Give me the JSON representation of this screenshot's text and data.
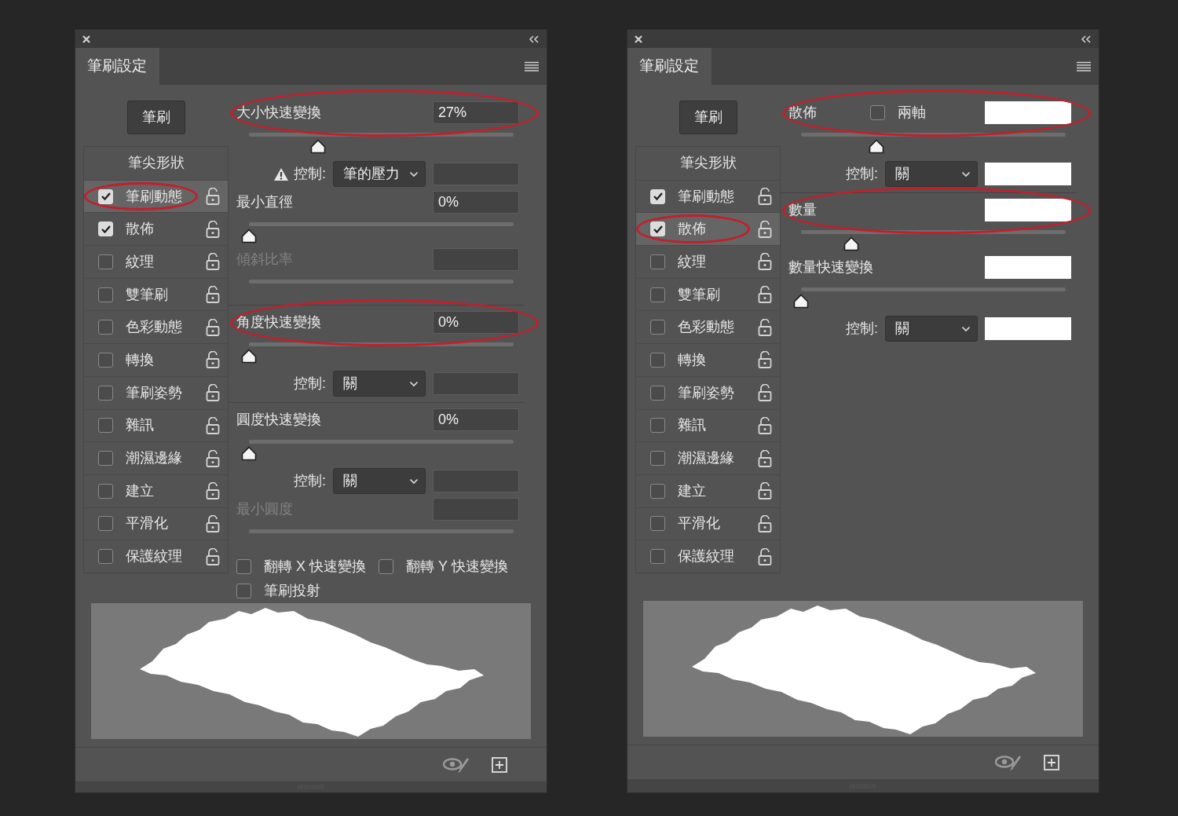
{
  "panels": [
    {
      "title": "筆刷設定",
      "tab_selected": true,
      "brush_button": "筆刷",
      "categories": [
        {
          "kind": "header",
          "label": "筆尖形狀"
        },
        {
          "kind": "option",
          "label": "筆刷動態",
          "checked": true,
          "selected": true,
          "circled": true
        },
        {
          "kind": "option",
          "label": "散佈",
          "checked": true,
          "selected": false,
          "circled": false
        },
        {
          "kind": "option",
          "label": "紋理",
          "checked": false,
          "selected": false,
          "circled": false
        },
        {
          "kind": "option",
          "label": "雙筆刷",
          "checked": false,
          "selected": false,
          "circled": false
        },
        {
          "kind": "option",
          "label": "色彩動態",
          "checked": false,
          "selected": false,
          "circled": false
        },
        {
          "kind": "option",
          "label": "轉換",
          "checked": false,
          "selected": false,
          "circled": false
        },
        {
          "kind": "option",
          "label": "筆刷姿勢",
          "checked": false,
          "selected": false,
          "circled": false
        },
        {
          "kind": "option",
          "label": "雜訊",
          "checked": false,
          "selected": false,
          "circled": false
        },
        {
          "kind": "option",
          "label": "潮濕邊緣",
          "checked": false,
          "selected": false,
          "circled": false
        },
        {
          "kind": "option",
          "label": "建立",
          "checked": false,
          "selected": false,
          "circled": false
        },
        {
          "kind": "option",
          "label": "平滑化",
          "checked": false,
          "selected": false,
          "circled": false
        },
        {
          "kind": "option",
          "label": "保護紋理",
          "checked": false,
          "selected": false,
          "circled": false
        }
      ],
      "settings": [
        {
          "kind": "slider",
          "label": "大小快速變換",
          "value": "27%",
          "level": 0.26,
          "disabled": false,
          "circled": true,
          "blanked": false
        },
        {
          "kind": "control",
          "label": "控制:",
          "option": "筆的壓力",
          "warning": true,
          "blanked": false
        },
        {
          "kind": "slider",
          "label": "最小直徑",
          "value": "0%",
          "level": 0,
          "disabled": false,
          "circled": false,
          "blanked": false
        },
        {
          "kind": "slider",
          "label": "傾斜比率",
          "disabled": true,
          "circled": false,
          "blanked": false
        },
        {
          "kind": "divider"
        },
        {
          "kind": "slider",
          "label": "角度快速變換",
          "value": "0%",
          "level": 0,
          "disabled": false,
          "circled": true,
          "blanked": false
        },
        {
          "kind": "control",
          "label": "控制:",
          "option": "關",
          "warning": false,
          "blanked": false
        },
        {
          "kind": "divider"
        },
        {
          "kind": "slider",
          "label": "圓度快速變換",
          "value": "0%",
          "level": 0,
          "disabled": false,
          "circled": false,
          "blanked": false
        },
        {
          "kind": "control",
          "label": "控制:",
          "option": "關",
          "warning": false,
          "blanked": false
        },
        {
          "kind": "slider",
          "label": "最小圓度",
          "disabled": true,
          "circled": false,
          "blanked": false
        },
        {
          "kind": "checkboxes",
          "items": [
            {
              "label": "翻轉 X 快速變換",
              "checked": false
            },
            {
              "label": "翻轉 Y 快速變換",
              "checked": false
            }
          ]
        },
        {
          "kind": "checkboxes",
          "items": [
            {
              "label": "筆刷投射",
              "checked": false
            }
          ]
        }
      ]
    },
    {
      "title": "筆刷設定",
      "tab_selected": true,
      "brush_button": "筆刷",
      "categories": [
        {
          "kind": "header",
          "label": "筆尖形狀"
        },
        {
          "kind": "option",
          "label": "筆刷動態",
          "checked": true,
          "selected": false,
          "circled": false
        },
        {
          "kind": "option",
          "label": "散佈",
          "checked": true,
          "selected": true,
          "circled": true
        },
        {
          "kind": "option",
          "label": "紋理",
          "checked": false,
          "selected": false,
          "circled": false
        },
        {
          "kind": "option",
          "label": "雙筆刷",
          "checked": false,
          "selected": false,
          "circled": false
        },
        {
          "kind": "option",
          "label": "色彩動態",
          "checked": false,
          "selected": false,
          "circled": false
        },
        {
          "kind": "option",
          "label": "轉換",
          "checked": false,
          "selected": false,
          "circled": false
        },
        {
          "kind": "option",
          "label": "筆刷姿勢",
          "checked": false,
          "selected": false,
          "circled": false
        },
        {
          "kind": "option",
          "label": "雜訊",
          "checked": false,
          "selected": false,
          "circled": false
        },
        {
          "kind": "option",
          "label": "潮濕邊緣",
          "checked": false,
          "selected": false,
          "circled": false
        },
        {
          "kind": "option",
          "label": "建立",
          "checked": false,
          "selected": false,
          "circled": false
        },
        {
          "kind": "option",
          "label": "平滑化",
          "checked": false,
          "selected": false,
          "circled": false
        },
        {
          "kind": "option",
          "label": "保護紋理",
          "checked": false,
          "selected": false,
          "circled": false
        }
      ],
      "settings": [
        {
          "kind": "slider",
          "label": "散佈",
          "level": 0.285,
          "disabled": false,
          "circled": true,
          "blanked": true,
          "option_checkbox": {
            "label": "兩軸",
            "checked": false
          }
        },
        {
          "kind": "control",
          "label": "控制:",
          "option": "關",
          "warning": false,
          "blanked": true
        },
        {
          "kind": "divider"
        },
        {
          "kind": "slider",
          "label": "數量",
          "level": 0.19,
          "disabled": false,
          "circled": true,
          "blanked": true
        },
        {
          "kind": "slider",
          "label": "數量快速變換",
          "level": 0,
          "disabled": false,
          "circled": false,
          "blanked": true
        },
        {
          "kind": "control",
          "label": "控制:",
          "option": "關",
          "warning": false,
          "blanked": true
        }
      ]
    }
  ]
}
